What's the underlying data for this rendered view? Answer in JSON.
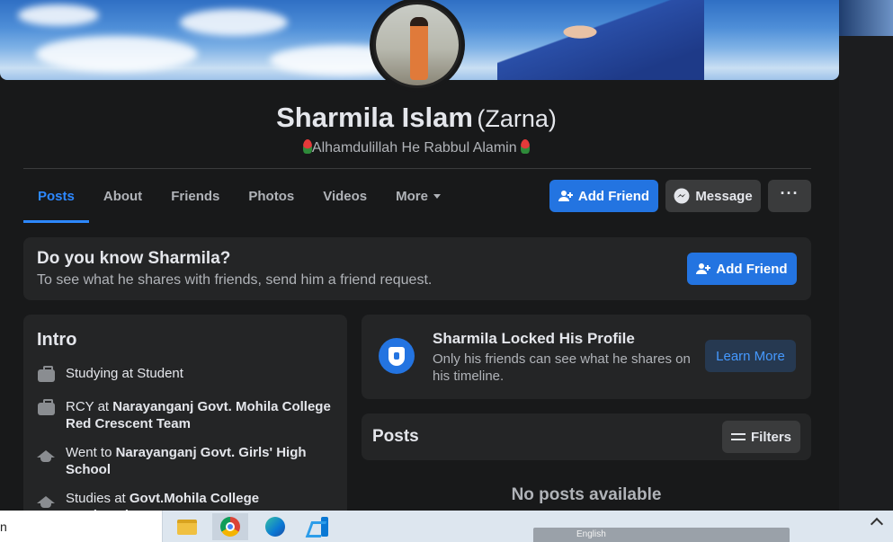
{
  "profile": {
    "name": "Sharmila Islam",
    "alt_name": "(Zarna)",
    "bio": "Alhamdulillah He Rabbul Alamin"
  },
  "tabs": [
    {
      "label": "Posts",
      "active": true
    },
    {
      "label": "About"
    },
    {
      "label": "Friends"
    },
    {
      "label": "Photos"
    },
    {
      "label": "Videos"
    },
    {
      "label": "More"
    }
  ],
  "actions": {
    "add_friend": "Add Friend",
    "message": "Message",
    "more": "···"
  },
  "know_card": {
    "title": "Do you know Sharmila?",
    "subtitle": "To see what he shares with friends, send him a friend request.",
    "button": "Add Friend"
  },
  "intro": {
    "title": "Intro",
    "items": [
      {
        "icon": "briefcase-icon",
        "prefix": "Studying at Student",
        "bold": ""
      },
      {
        "icon": "briefcase-icon",
        "prefix": "RCY at ",
        "bold": "Narayanganj Govt. Mohila College Red Crescent Team"
      },
      {
        "icon": "graduation-cap-icon",
        "prefix": "Went to ",
        "bold": "Narayanganj Govt. Girls' High School"
      },
      {
        "icon": "graduation-cap-icon",
        "prefix": "Studies at ",
        "bold": "Govt.Mohila College &University,"
      }
    ]
  },
  "locked": {
    "title": "Sharmila Locked His Profile",
    "subtitle": "Only his friends can see what he shares on his timeline.",
    "button": "Learn More"
  },
  "posts": {
    "title": "Posts",
    "filters": "Filters",
    "empty": "No posts available"
  },
  "taskbar": {
    "search_fragment": "n",
    "tray_language": "English"
  },
  "colors": {
    "background": "#18191a",
    "card": "#242526",
    "primary": "#2374e1",
    "active_tab": "#2d88ff"
  }
}
